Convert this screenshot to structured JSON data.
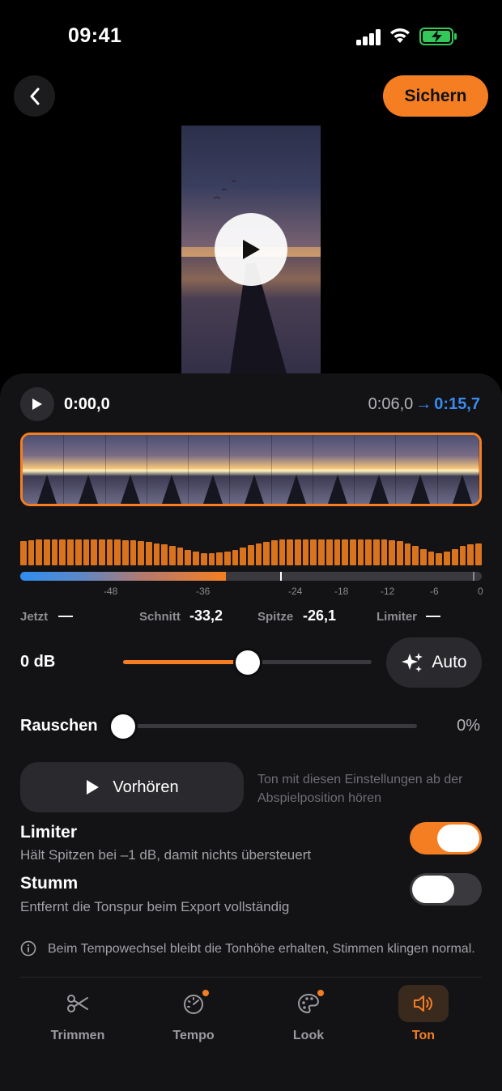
{
  "status_bar": {
    "time": "09:41"
  },
  "top_bar": {
    "save_label": "Sichern"
  },
  "player": {
    "current_time": "0:00,0",
    "range_start": "0:06,0",
    "range_arrow": "→",
    "range_end": "0:15,7"
  },
  "meter": {
    "level_fraction": 0.445,
    "scale_labels": [
      "-48",
      "-36",
      "-24",
      "-18",
      "-12",
      "-6",
      "0"
    ]
  },
  "stats": [
    {
      "label": "Jetzt",
      "value": "—"
    },
    {
      "label": "Schnitt",
      "value": "-33,2"
    },
    {
      "label": "Spitze",
      "value": "-26,1"
    },
    {
      "label": "Limiter",
      "value": "—"
    }
  ],
  "volume": {
    "label": "0 dB",
    "level_fraction": 0.5,
    "auto_label": "Auto"
  },
  "noise": {
    "label": "Rauschen",
    "value": "0%",
    "level_fraction": 0.0
  },
  "preview_listen": {
    "label": "Vorhören",
    "hint": "Ton mit diesen Einstellungen ab der Abspielposition hören"
  },
  "limiter": {
    "title": "Limiter",
    "subtitle": "Hält Spitzen bei –1 dB, damit nichts übersteuert",
    "on": true
  },
  "mute": {
    "title": "Stumm",
    "subtitle": "Entfernt die Tonspur beim Export vollständig",
    "on": false
  },
  "info": {
    "text": "Beim Tempowechsel bleibt die Tonhöhe erhalten, Stimmen klingen normal."
  },
  "tabs": [
    {
      "label": "Trimmen",
      "icon": "scissors-icon",
      "badge": false,
      "active": false
    },
    {
      "label": "Tempo",
      "icon": "speedometer-icon",
      "badge": true,
      "active": false
    },
    {
      "label": "Look",
      "icon": "palette-icon",
      "badge": true,
      "active": false
    },
    {
      "label": "Ton",
      "icon": "speaker-icon",
      "badge": false,
      "active": true
    }
  ],
  "colors": {
    "accent": "#f57e22",
    "link_blue": "#3b8af0",
    "panel": "#131316"
  },
  "waveform_levels": [
    0.82,
    0.86,
    0.88,
    0.9,
    0.9,
    0.9,
    0.9,
    0.9,
    0.9,
    0.9,
    0.9,
    0.9,
    0.88,
    0.86,
    0.86,
    0.84,
    0.8,
    0.76,
    0.72,
    0.66,
    0.6,
    0.52,
    0.46,
    0.42,
    0.42,
    0.44,
    0.48,
    0.54,
    0.62,
    0.7,
    0.74,
    0.8,
    0.86,
    0.9,
    0.9,
    0.9,
    0.9,
    0.9,
    0.9,
    0.9,
    0.9,
    0.9,
    0.9,
    0.9,
    0.9,
    0.9,
    0.88,
    0.86,
    0.82,
    0.76,
    0.66,
    0.56,
    0.46,
    0.42,
    0.46,
    0.56,
    0.66,
    0.72,
    0.76
  ]
}
